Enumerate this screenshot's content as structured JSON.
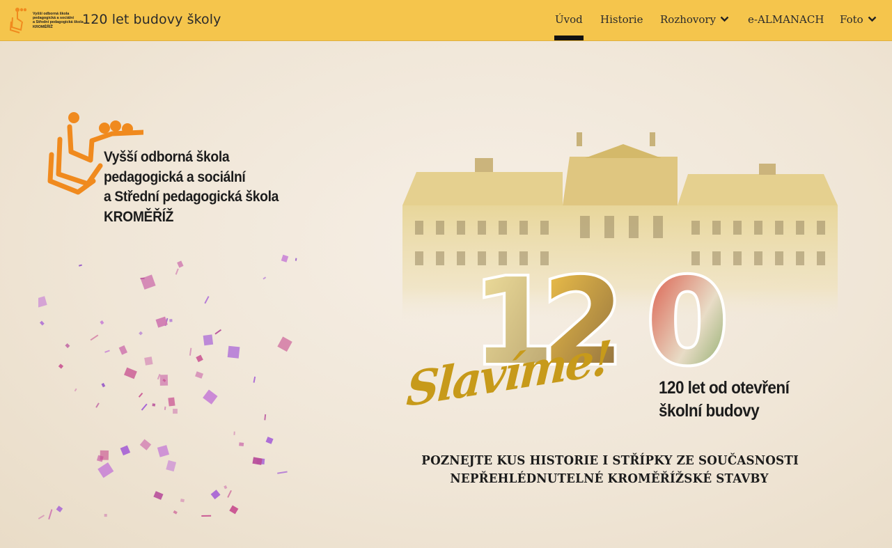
{
  "header": {
    "logo_text": "Vyšší odborná škola\npedagogická a sociální\na Střední pedagogická škola\nKROMĚŘÍŽ",
    "site_title": "120 let budovy školy",
    "menu": [
      {
        "label": "Úvod",
        "active": true
      },
      {
        "label": "Historie"
      },
      {
        "label": "Rozhovory",
        "has_dropdown": true
      },
      {
        "label": "e-ALMANACH"
      },
      {
        "label": "Foto",
        "has_dropdown": true
      }
    ],
    "accent_color": "#f5c54c"
  },
  "hero": {
    "school_name_lines": [
      "Vyšší odborná škola",
      "pedagogická a sociální",
      "a Střední pedagogická škola",
      "KROMĚŘÍŽ"
    ],
    "big_number": "120",
    "slogan": "Slavíme!",
    "anniversary_lines": [
      "120 let od otevření",
      "školní budovy"
    ],
    "tagline_lines": [
      "POZNEJTE KUS HISTORIE I STŘÍPKY ZE SOUČASNOSTI",
      "NEPŘEHLÉDNUTELNÉ KROMĚŘÍŽSKÉ STAVBY"
    ],
    "logo_color": "#f08a1e",
    "slogan_color": "#c79a1a"
  }
}
